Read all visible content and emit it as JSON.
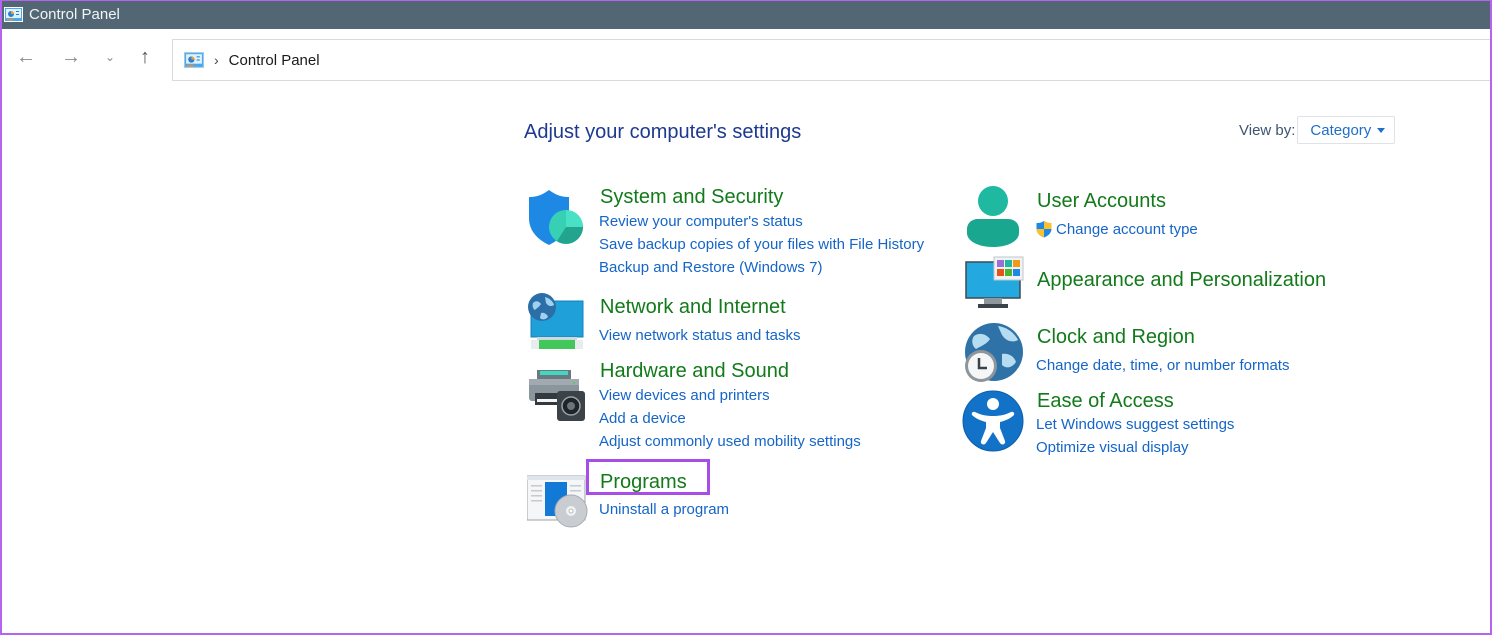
{
  "window": {
    "title": "Control Panel",
    "app_icon": "control-panel-icon"
  },
  "navigation": {
    "back_icon": "←",
    "forward_icon": "→",
    "recent_icon": "⌄",
    "up_icon": "↑",
    "breadcrumb_separator": "›",
    "breadcrumb": [
      "Control Panel"
    ]
  },
  "main": {
    "heading": "Adjust your computer's settings",
    "view_by": {
      "label": "View by:",
      "selected": "Category"
    },
    "categories_left": [
      {
        "title": "System and Security",
        "icon": "shield-icon",
        "links": [
          "Review your computer's status",
          "Save backup copies of your files with File History",
          "Backup and Restore (Windows 7)"
        ]
      },
      {
        "title": "Network and Internet",
        "icon": "network-globe-icon",
        "links": [
          "View network status and tasks"
        ]
      },
      {
        "title": "Hardware and Sound",
        "icon": "printer-speaker-icon",
        "links": [
          "View devices and printers",
          "Add a device",
          "Adjust commonly used mobility settings"
        ]
      },
      {
        "title": "Programs",
        "icon": "programs-disc-icon",
        "links": [
          "Uninstall a program"
        ],
        "highlighted": true
      }
    ],
    "categories_right": [
      {
        "title": "User Accounts",
        "icon": "user-icon",
        "links": [
          "Change account type"
        ],
        "link_icon": "uac-shield-icon"
      },
      {
        "title": "Appearance and Personalization",
        "icon": "monitor-palette-icon",
        "links": []
      },
      {
        "title": "Clock and Region",
        "icon": "clock-globe-icon",
        "links": [
          "Change date, time, or number formats"
        ]
      },
      {
        "title": "Ease of Access",
        "icon": "accessibility-icon",
        "links": [
          "Let Windows suggest settings",
          "Optimize visual display"
        ]
      }
    ]
  },
  "colors": {
    "titlebar": "#526673",
    "heading": "#1c3a8f",
    "category_title": "#127a1a",
    "link": "#1565c8",
    "highlight": "#a84ee8"
  }
}
